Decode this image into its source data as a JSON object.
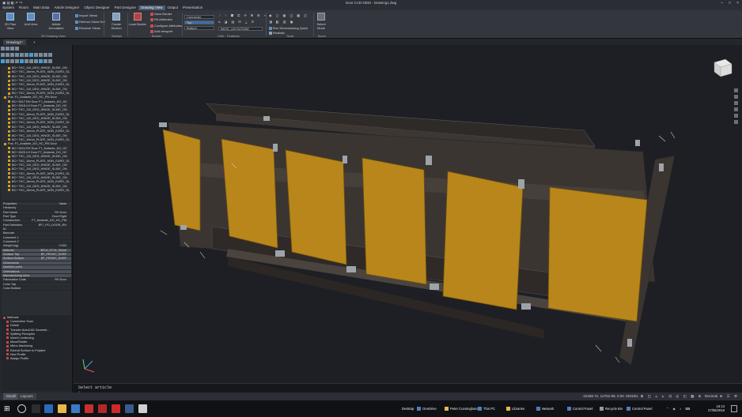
{
  "window": {
    "title": "imos CAD-OEM - Drawing1.dwg"
  },
  "menu": [
    "System",
    "Room",
    "Main Data",
    "Article Designer",
    "Object Designer",
    "Part Designer",
    "Drawing View",
    "Output",
    "Presentation"
  ],
  "menu_active_index": 6,
  "ribbon": {
    "buttons_large": [
      "2D Plan View",
      "Unit View",
      "Article Annotation",
      "Create Section",
      "Load Border",
      "Select Mode"
    ],
    "small_left": [
      "Import Views",
      "Refresh Sheet Set",
      "Rename Views"
    ],
    "small_border": [
      "Save Border",
      "Fill Attributes",
      "Configure Attributes",
      "Add viewport"
    ],
    "dropdowns": [
      "Connector",
      "Top",
      "Bottom",
      "IMOS_LAYOUTDIM"
    ],
    "small_tools": [
      "Run Dimensioning Quick",
      "Realistic"
    ],
    "panel_labels": [
      "2D Drawing View",
      "Section",
      "Border",
      "CAD - Features",
      "Tools",
      "Touch"
    ]
  },
  "document_tab": "Drawing1*",
  "tree_items": [
    "BC+ TKC_110_DEG_HINGE_SLIDE_ON",
    "BC+ TKC_16mm_PLATE_NON_EURO_SL",
    "BC+ TKC_110_DEG_HINGE_SLIDE_ON",
    "BC+ TKC_110_DEG_HINGE_SLIDE_ON",
    "BC+ TKC_16mm_PLATE_NON_EURO_SL",
    "BC+ TKC_110_DEG_HINGE_SLIDE_ON",
    "BC+ TKC_16mm_PLATE_NON_EURO_SL",
    "Pos. F1_Andante_DO_HC_PM Door",
    "BC+ 5017 RH Door F7_Andante_DO_HC",
    "BC+ 5018 LH Door F7_Andante_DO_HC",
    "BC+ TKC_110_DEG_HINGE_SLIDE_ON",
    "BC+ TKC_16mm_PLATE_NON_EURO_SL",
    "BC+ TKC_110_DEG_HINGE_SLIDE_ON",
    "BC+ TKC_16mm_PLATE_NON_EURO_SL",
    "BC+ TKC_110_DEG_HINGE_SLIDE_ON",
    "BC+ TKC_16mm_PLATE_NON_EURO_SL",
    "BC+ TKC_110_DEG_HINGE_SLIDE_ON",
    "BC+ TKC_16mm_PLATE_NON_EURO_SL",
    "Pos. F1_Andante_DO_HC_PM Door",
    "BC+ 5024 RH Door F7_Andante_DO_HC",
    "BC+ 5025 LH Door F7_Andante_DO_HC",
    "BC+ TKC_110_DEG_HINGE_SLIDE_ON",
    "BC+ TKC_16mm_PLATE_NON_EURO_SL",
    "BC+ TKC_110_DEG_HINGE_SLIDE_ON",
    "BC+ TKC_110_DEG_HINGE_SLIDE_ON",
    "BC+ TKC_16mm_PLATE_NON_EURO_SL",
    "BC+ TKC_110_DEG_HINGE_SLIDE_ON",
    "BC+ TKC_16mm_PLATE_NON_EURO_SL",
    "BC+ TKC_110_DEG_HINGE_SLIDE_ON",
    "BC+ TKC_16mm_PLATE_NON_EURO_SL"
  ],
  "properties": {
    "header": [
      "Properties",
      "Value"
    ],
    "rows": [
      {
        "k": "Hierarchy",
        "v": ""
      },
      {
        "k": "Part Name",
        "v": "RH Door"
      },
      {
        "k": "Part Type",
        "v": "Door Right"
      },
      {
        "k": "Construction",
        "v": "F7_Andante_DO_HC_PM"
      },
      {
        "k": "Part Definition",
        "v": "$F7_PO_DOOR_RH"
      },
      {
        "k": "ID",
        "v": ""
      },
      {
        "k": "Barcode",
        "v": ""
      },
      {
        "k": "Comment 1",
        "v": ""
      },
      {
        "k": "Comment 2",
        "v": ""
      },
      {
        "k": "Weight (kg)",
        "v": "0.000"
      },
      {
        "k": "Material",
        "v": "$F14_ST15_16mm"
      },
      {
        "k": "Surface Top",
        "v": "$F_FRONT_SURF"
      },
      {
        "k": "Surface Bottom",
        "v": "$F_FRONT_SURF"
      },
      {
        "k": "Dimensions",
        "v": ""
      },
      {
        "k": "Insertion point",
        "v": ""
      },
      {
        "k": "Orientations",
        "v": ""
      },
      {
        "k": "Manufacturing Infos",
        "v": ""
      },
      {
        "k": "Fabrication Code",
        "v": "RH Door"
      },
      {
        "k": "Color Top",
        "v": ""
      },
      {
        "k": "Color Bottom",
        "v": ""
      }
    ]
  },
  "methods": [
    "Methods",
    "Connection Scan",
    "Delete",
    "Transfer AutoCAD Geometr...",
    "Splitting Principles",
    "Inherit Limitioning",
    "Move/Rotate",
    "Mirror Machining",
    "Extend Surface to Polyline",
    "New Profile",
    "Assign Profile"
  ],
  "command": {
    "prompt": "Select article",
    "sub": "?"
  },
  "layout_tabs": [
    "Model",
    "Layout1"
  ],
  "status": {
    "coords": "-22458.72, 12762.99, 0.00",
    "mode": "MODEL",
    "units": "Decimal"
  },
  "taskbar": {
    "items": [
      "OneDrive",
      "Peter Cunningham",
      "This PC",
      "Libraries",
      "Network",
      "Control Panel",
      "Recycle Bin",
      "Control Panel"
    ],
    "desktop_label": "Desktop",
    "time": "16:13",
    "date": "27/06/2016"
  },
  "colors": {
    "ribbon_accent": "#4a5a72",
    "door_panel": "#b8861a",
    "carcass": "#3a3430",
    "viewport_bg": "#1d1f24"
  }
}
